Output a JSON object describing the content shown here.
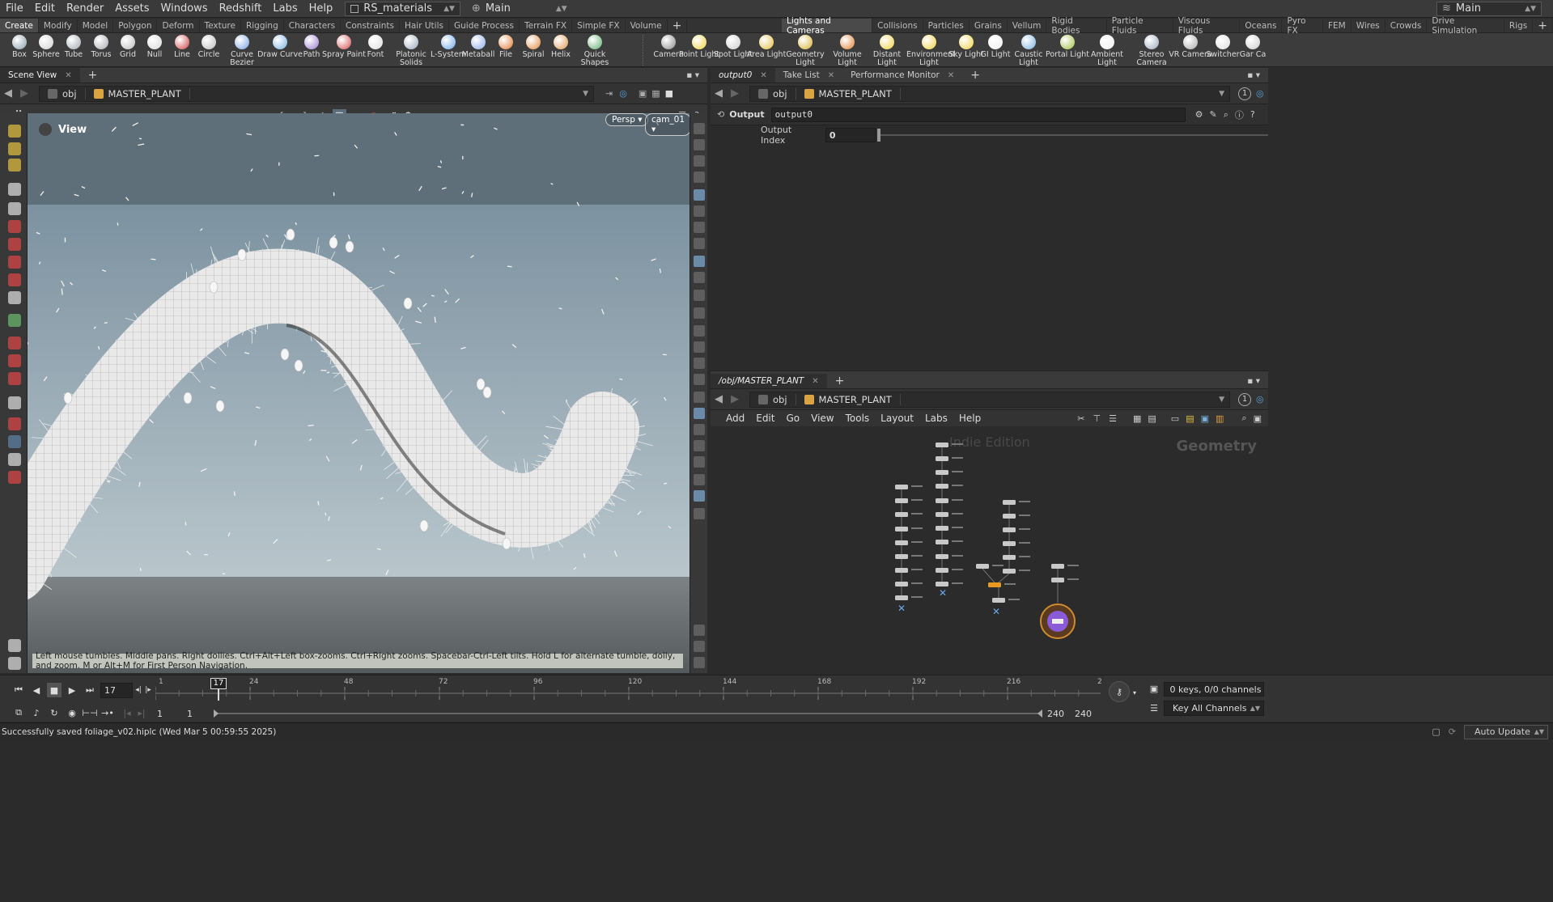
{
  "menubar": {
    "items": [
      "File",
      "Edit",
      "Render",
      "Assets",
      "Windows",
      "Redshift",
      "Labs",
      "Help"
    ],
    "scene_file": "RS_materials",
    "desktop": "Main",
    "right_desktop": "Main"
  },
  "shelf_tabs_left": [
    "Create",
    "Modify",
    "Model",
    "Polygon",
    "Deform",
    "Texture",
    "Rigging",
    "Characters",
    "Constraints",
    "Hair Utils",
    "Guide Process",
    "Terrain FX",
    "Simple FX",
    "Volume"
  ],
  "shelf_tabs_right": [
    "Lights and Cameras",
    "Collisions",
    "Particles",
    "Grains",
    "Vellum",
    "Rigid Bodies",
    "Particle Fluids",
    "Viscous Fluids",
    "Oceans",
    "Pyro FX",
    "FEM",
    "Wires",
    "Crowds",
    "Drive Simulation",
    "Rigs"
  ],
  "shelf_tools_left": [
    {
      "label": "Box",
      "icon": "box-icon"
    },
    {
      "label": "Sphere",
      "icon": "sphere-icon"
    },
    {
      "label": "Tube",
      "icon": "tube-icon"
    },
    {
      "label": "Torus",
      "icon": "torus-icon"
    },
    {
      "label": "Grid",
      "icon": "grid-icon"
    },
    {
      "label": "Null",
      "icon": "null-icon"
    },
    {
      "label": "Line",
      "icon": "line-icon"
    },
    {
      "label": "Circle",
      "icon": "circle-icon"
    },
    {
      "label": "Curve Bezier",
      "icon": "curve-bezier-icon"
    },
    {
      "label": "Draw Curve",
      "icon": "draw-curve-icon"
    },
    {
      "label": "Path",
      "icon": "path-icon"
    },
    {
      "label": "Spray Paint",
      "icon": "spray-paint-icon"
    },
    {
      "label": "Font",
      "icon": "font-icon"
    },
    {
      "label": "Platonic Solids",
      "icon": "platonic-solids-icon"
    },
    {
      "label": "L-System",
      "icon": "l-system-icon"
    },
    {
      "label": "Metaball",
      "icon": "metaball-icon"
    },
    {
      "label": "File",
      "icon": "file-icon"
    },
    {
      "label": "Spiral",
      "icon": "spiral-icon"
    },
    {
      "label": "Helix",
      "icon": "helix-icon"
    },
    {
      "label": "Quick Shapes",
      "icon": "quick-shapes-icon"
    }
  ],
  "shelf_tools_right": [
    {
      "label": "Camera",
      "icon": "camera-icon"
    },
    {
      "label": "Point Light",
      "icon": "point-light-icon"
    },
    {
      "label": "Spot Light",
      "icon": "spot-light-icon"
    },
    {
      "label": "Area Light",
      "icon": "area-light-icon"
    },
    {
      "label": "Geometry Light",
      "icon": "geometry-light-icon"
    },
    {
      "label": "Volume Light",
      "icon": "volume-light-icon"
    },
    {
      "label": "Distant Light",
      "icon": "distant-light-icon"
    },
    {
      "label": "Environment Light",
      "icon": "environment-light-icon"
    },
    {
      "label": "Sky Light",
      "icon": "sky-light-icon"
    },
    {
      "label": "GI Light",
      "icon": "gi-light-icon"
    },
    {
      "label": "Caustic Light",
      "icon": "caustic-light-icon"
    },
    {
      "label": "Portal Light",
      "icon": "portal-light-icon"
    },
    {
      "label": "Ambient Light",
      "icon": "ambient-light-icon"
    },
    {
      "label": "Stereo Camera",
      "icon": "stereo-camera-icon"
    },
    {
      "label": "VR Camera",
      "icon": "vr-camera-icon"
    },
    {
      "label": "Switcher",
      "icon": "switcher-icon"
    },
    {
      "label": "Gar Ca",
      "icon": "gamepad-camera-icon"
    }
  ],
  "scene_view": {
    "tab": "Scene View",
    "path_root": "obj",
    "path_node": "MASTER_PLANT",
    "view_label": "View",
    "persp": "Persp",
    "camera": "cam_01",
    "hint": "Left mouse tumbles. Middle pans. Right dollies. Ctrl+Alt+Left box-zooms. Ctrl+Right zooms. Spacebar-Ctrl-Left tilts. Hold L for alternate tumble, dolly, and zoom. M or Alt+M for First Person Navigation."
  },
  "params": {
    "tabs": [
      "output0",
      "Take List",
      "Performance Monitor"
    ],
    "path_root": "obj",
    "path_node": "MASTER_PLANT",
    "node_type": "Output",
    "node_name": "output0",
    "output_index_label": "Output Index",
    "output_index_value": "0",
    "badge": "1"
  },
  "network": {
    "tab": "/obj/MASTER_PLANT",
    "path_root": "obj",
    "path_node": "MASTER_PLANT",
    "menu": [
      "Add",
      "Edit",
      "Go",
      "View",
      "Tools",
      "Layout",
      "Labs",
      "Help"
    ],
    "watermark": "Indie Edition",
    "context": "Geometry",
    "badge": "1"
  },
  "timeline": {
    "current_frame": "17",
    "marker_frame": "17",
    "ticks": [
      "1",
      "24",
      "48",
      "72",
      "96",
      "120",
      "144",
      "168",
      "192",
      "216",
      "2"
    ],
    "start": "1",
    "start2": "1",
    "end": "240",
    "end2": "240",
    "keys_info": "0 keys, 0/0 channels",
    "key_all": "Key All Channels",
    "auto_update": "Auto Update"
  },
  "status": {
    "message": "Successfully saved foliage_v02.hiplc (Wed Mar  5 00:59:55 2025)"
  }
}
